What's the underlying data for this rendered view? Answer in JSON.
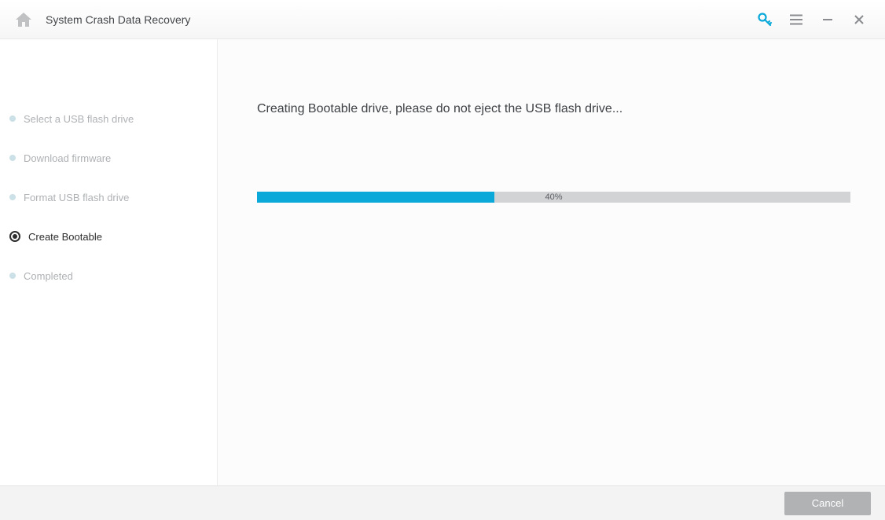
{
  "titlebar": {
    "title": "System Crash Data Recovery"
  },
  "sidebar": {
    "steps": [
      {
        "label": "Select a USB flash drive"
      },
      {
        "label": "Download firmware"
      },
      {
        "label": "Format USB flash drive"
      },
      {
        "label": "Create Bootable"
      },
      {
        "label": "Completed"
      }
    ]
  },
  "main": {
    "status_text": "Creating Bootable drive, please do not eject the USB flash drive...",
    "progress_label": "40%",
    "progress_width": "40%"
  },
  "footer": {
    "cancel_label": "Cancel"
  },
  "colors": {
    "accent": "#0aa9da",
    "key_icon": "#0aa9da"
  }
}
